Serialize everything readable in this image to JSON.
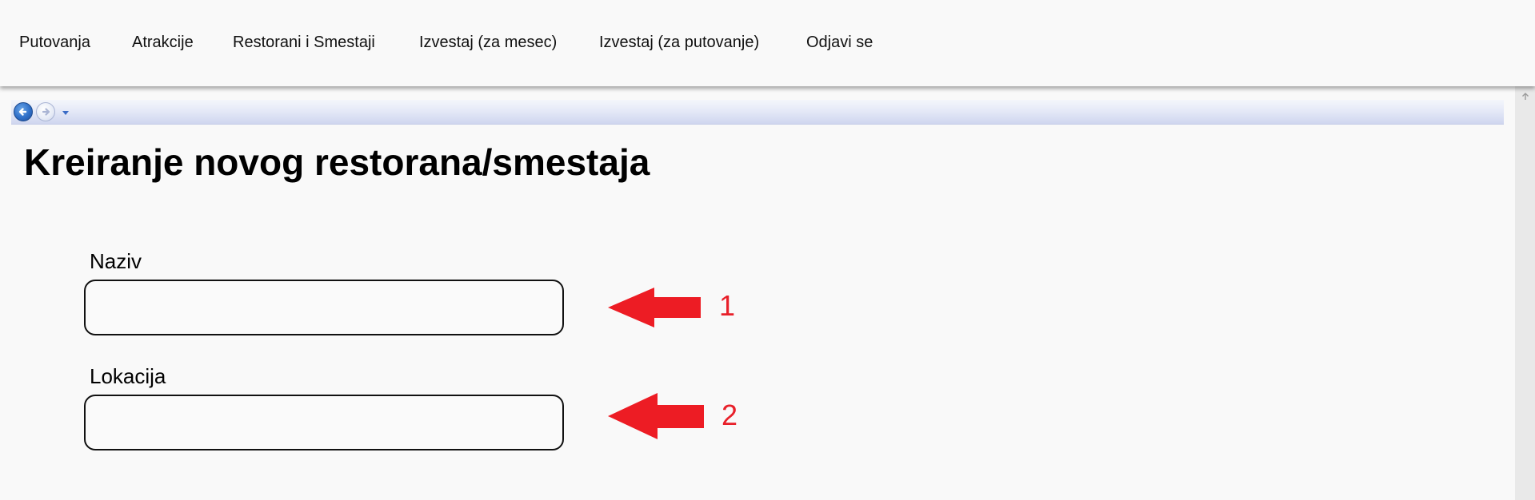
{
  "nav": {
    "items": [
      {
        "label": "Putovanja"
      },
      {
        "label": "Atrakcije"
      },
      {
        "label": "Restorani i Smestaji"
      },
      {
        "label": "Izvestaj (za mesec)"
      },
      {
        "label": "Izvestaj (za putovanje)"
      },
      {
        "label": "Odjavi se"
      }
    ]
  },
  "frame_toolbar": {
    "icons": [
      "back-arrow-icon",
      "forward-arrow-icon",
      "dropdown-triangle-icon"
    ]
  },
  "page": {
    "title": "Kreiranje novog restorana/smestaja"
  },
  "form": {
    "naziv": {
      "label": "Naziv",
      "value": "",
      "placeholder": ""
    },
    "lokacija": {
      "label": "Lokacija",
      "value": "",
      "placeholder": ""
    }
  },
  "annotations": {
    "arrow1": "1",
    "arrow2": "2",
    "color": "#ed1c24"
  },
  "colors": {
    "background": "#f9f9f9",
    "toolbar_gradient_end": "#cfd6ef",
    "back_button": "#2f6fc8"
  }
}
